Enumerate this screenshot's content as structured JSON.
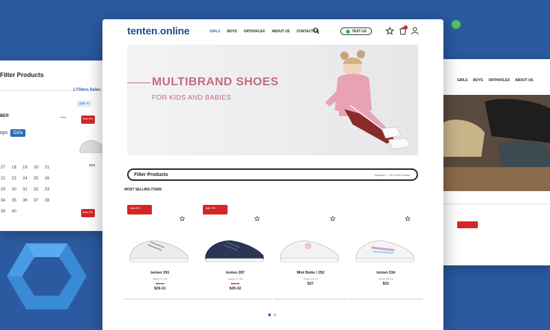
{
  "brand": {
    "name_main": "tenten",
    "name_dot": ".",
    "name_tail": "online"
  },
  "nav": {
    "items": [
      "GIRLS",
      "BOYS",
      "ORTHOFLEX",
      "ABOUT US",
      "CONTACT US"
    ]
  },
  "header": {
    "text_us_label": "TEXT US"
  },
  "hero": {
    "title": "MULTIBRAND SHOES",
    "subtitle": "FOR KIDS AND BABIES"
  },
  "filter": {
    "title": "Filter Products",
    "count_text": "Showing 1 - 40 of 502 results"
  },
  "section": {
    "title": "MOST SELLING ITEMS"
  },
  "products": [
    {
      "sale": "Sale 9%",
      "name": "tenten 291",
      "sizes": "Sizes 37-36",
      "old_price": "$31.99",
      "price": "$29-31"
    },
    {
      "sale": "Sale 9%",
      "name": "tenten 287",
      "sizes": "Sizes 27-40",
      "old_price": "$31.99",
      "price": "$29-32"
    },
    {
      "sale": "",
      "name": "Mini Botte / 292",
      "sizes": "Sizes 23-24",
      "old_price": "",
      "price": "$27"
    },
    {
      "sale": "",
      "name": "tenten 534",
      "sizes": "Sizes 28-34",
      "old_price": "",
      "price": "$31"
    }
  ],
  "left_window": {
    "title": "Filter Products",
    "filters_selected": "1 Filters Selec",
    "chip": "girls",
    "section": "BER",
    "tags": [
      "oys",
      "Girls"
    ],
    "sizes": [
      "27",
      "18",
      "19",
      "20",
      "21",
      "22",
      "23",
      "24",
      "25",
      "26",
      "29",
      "30",
      "31",
      "32",
      "33",
      "34",
      "35",
      "36",
      "37",
      "38",
      "39",
      "40"
    ],
    "sale": "Sale 9%",
    "name": "tent"
  },
  "right_window": {
    "nav": [
      "GIRLS",
      "BOYS",
      "ORTHOFLEX",
      "ABOUT US"
    ]
  },
  "colors": {
    "background": "#2b5aa0",
    "accent": "#2a6bb8",
    "sale": "#d32727",
    "hero_text": "#c56b7c"
  }
}
